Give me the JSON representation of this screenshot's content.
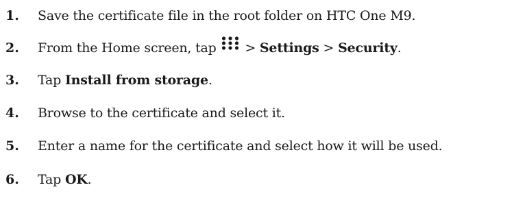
{
  "steps": [
    {
      "number": "1.",
      "text": "Save the certificate file in the root folder on HTC One M9."
    },
    {
      "number": "2.",
      "before_icon": "From the Home screen, tap",
      "icon": "apps-grid-icon",
      "sep1": ">",
      "settings": "Settings",
      "sep2": ">",
      "security": "Security",
      "end": "."
    },
    {
      "number": "3.",
      "prefix": "Tap",
      "bold": "Install from storage",
      "end": "."
    },
    {
      "number": "4.",
      "text": "Browse to the certificate and select it."
    },
    {
      "number": "5.",
      "text": "Enter a name for the certificate and select how it will be used."
    },
    {
      "number": "6.",
      "prefix": "Tap",
      "bold": "OK",
      "end": "."
    }
  ]
}
